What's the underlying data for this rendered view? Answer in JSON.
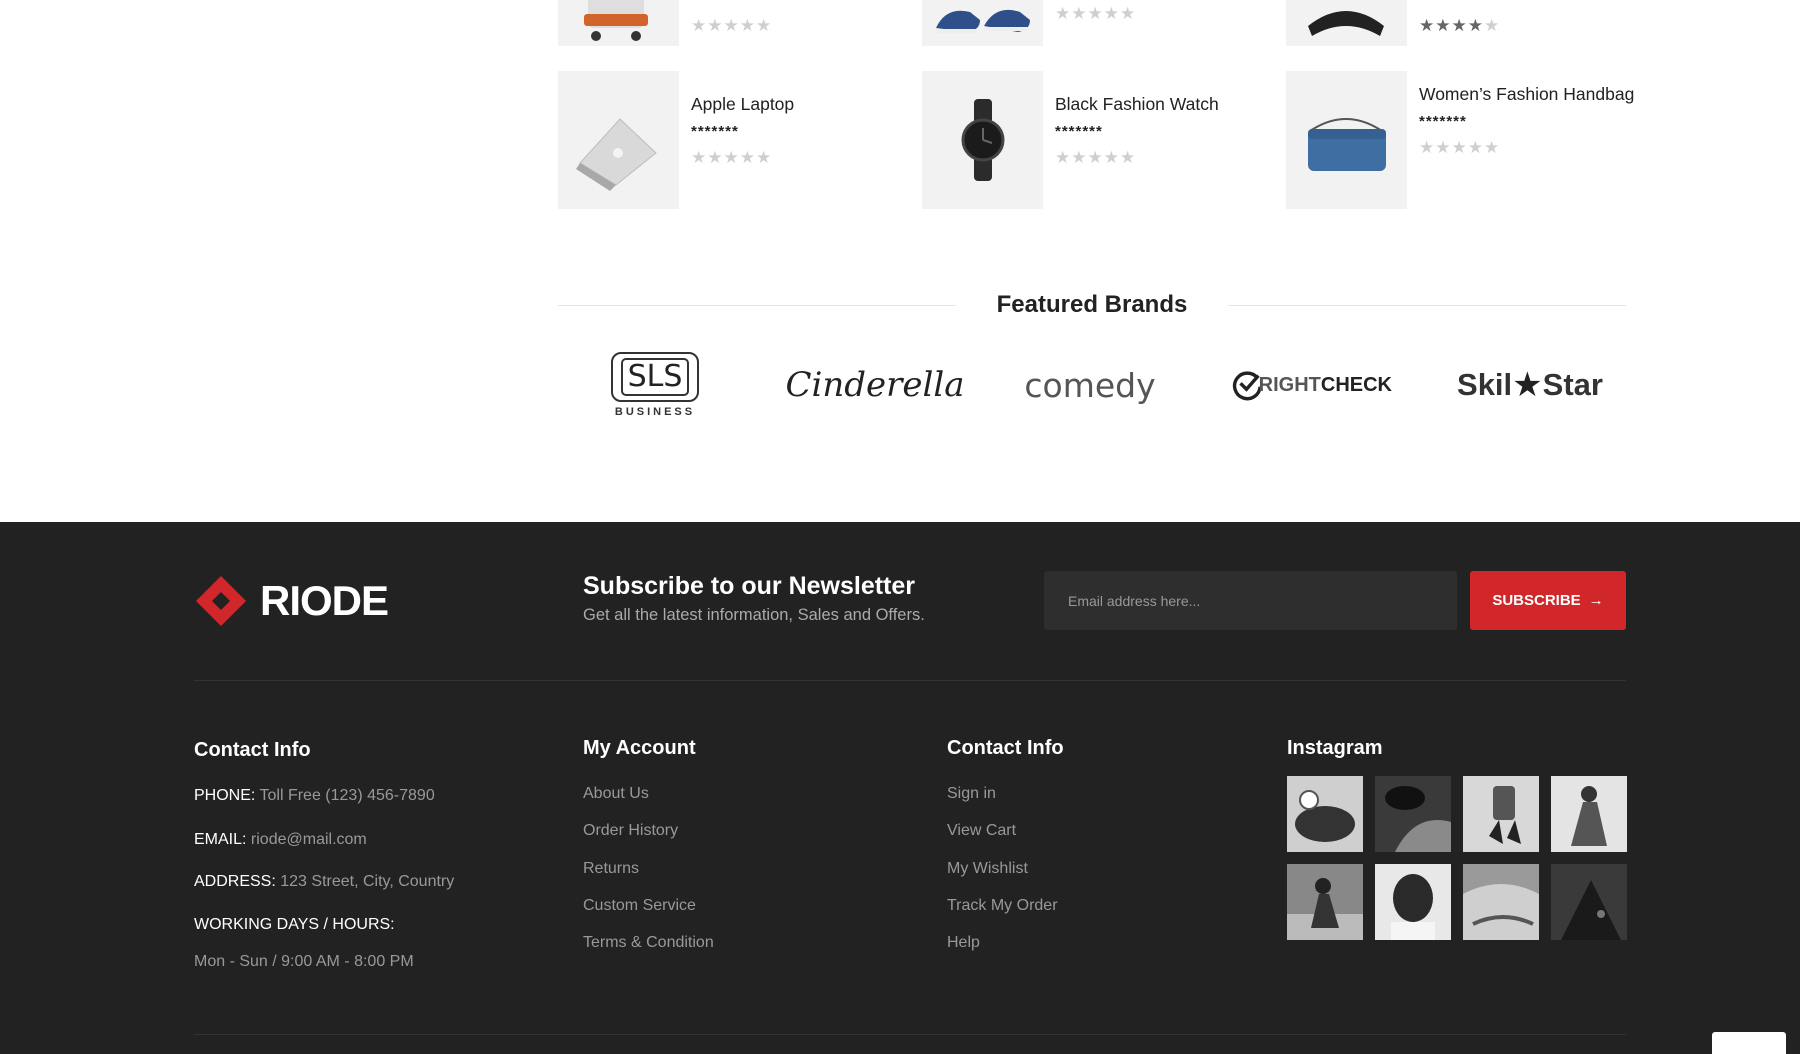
{
  "products": [
    {
      "name": "",
      "price": "",
      "rating": 0,
      "thumb": "suitcase"
    },
    {
      "name": "",
      "price": "",
      "rating": 0,
      "thumb": "shoes"
    },
    {
      "name": "",
      "price": "",
      "rating": 4,
      "thumb": "bag"
    },
    {
      "name": "Apple Laptop",
      "price": "*******",
      "rating": 0,
      "thumb": "laptop"
    },
    {
      "name": "Black Fashion Watch",
      "price": "*******",
      "rating": 0,
      "thumb": "watch"
    },
    {
      "name": "Women’s Fashion Handbag",
      "price": "*******",
      "rating": 0,
      "thumb": "handbag"
    }
  ],
  "featured_brands": {
    "title": "Featured Brands",
    "logos": [
      {
        "name": "SLS Business",
        "text": "SLS",
        "sub": "BUSINESS"
      },
      {
        "name": "Cinderella",
        "text": "Cinderella"
      },
      {
        "name": "comedy",
        "text": "comedy"
      },
      {
        "name": "Rightcheck",
        "text_a": "RIGHT",
        "text_b": "CHECK"
      },
      {
        "name": "SkillStar",
        "text_a": "Skil",
        "text_b": "Star"
      }
    ]
  },
  "footer": {
    "logo_text": "RIODE",
    "newsletter": {
      "title": "Subscribe to our Newsletter",
      "subtitle": "Get all the latest information, Sales and Offers.",
      "placeholder": "Email address here...",
      "button": "SUBSCRIBE"
    },
    "contact": {
      "title": "Contact Info",
      "phone_label": "PHONE:",
      "phone": "Toll Free (123) 456-7890",
      "email_label": "EMAIL:",
      "email": "riode@mail.com",
      "address_label": "ADDRESS:",
      "address": "123 Street, City, Country",
      "hours_label": "WORKING DAYS / HOURS:",
      "hours": "Mon - Sun / 9:00 AM - 8:00 PM"
    },
    "my_account": {
      "title": "My Account",
      "links": [
        "About Us",
        "Order History",
        "Returns",
        "Custom Service",
        "Terms & Condition"
      ]
    },
    "contact_links": {
      "title": "Contact Info",
      "links": [
        "Sign in",
        "View Cart",
        "My Wishlist",
        "Track My Order",
        "Help"
      ]
    },
    "instagram": {
      "title": "Instagram",
      "count": 8
    }
  },
  "colors": {
    "accent": "#d1272b",
    "footer_bg": "#222222",
    "star_off": "#cfcfcf",
    "star_on": "#666666"
  }
}
